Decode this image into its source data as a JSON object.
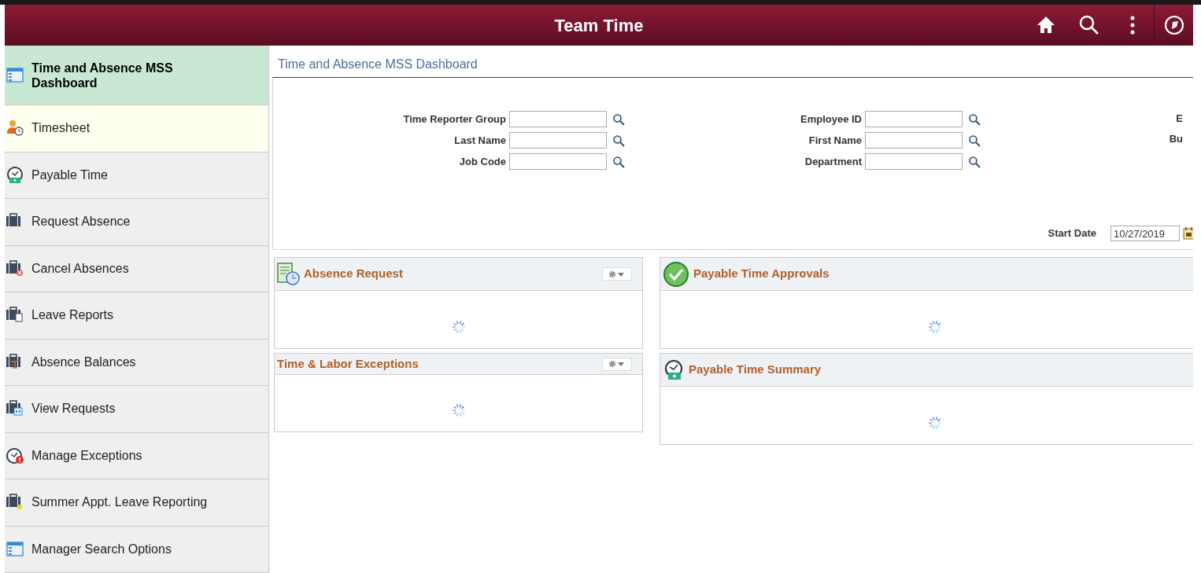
{
  "header": {
    "title": "Team Time",
    "actions": [
      {
        "kind": "home"
      },
      {
        "kind": "search"
      },
      {
        "kind": "more"
      },
      {
        "kind": "navbar"
      }
    ]
  },
  "sidebar": {
    "items": [
      {
        "label": "Time and Absence MSS Dashboard",
        "kind": "window",
        "selected": true,
        "hovered": false
      },
      {
        "label": "Timesheet",
        "kind": "person-clock",
        "selected": false,
        "hovered": true
      },
      {
        "label": "Payable Time",
        "kind": "clock-money",
        "selected": false,
        "hovered": false
      },
      {
        "label": "Request Absence",
        "kind": "briefcase",
        "selected": false,
        "hovered": false
      },
      {
        "label": "Cancel Absences",
        "kind": "briefcase-x",
        "selected": false,
        "hovered": false
      },
      {
        "label": "Leave Reports",
        "kind": "briefcase-doc",
        "selected": false,
        "hovered": false
      },
      {
        "label": "Absence Balances",
        "kind": "briefcase-scale",
        "selected": false,
        "hovered": false
      },
      {
        "label": "View Requests",
        "kind": "briefcase-calendar",
        "selected": false,
        "hovered": false
      },
      {
        "label": "Manage Exceptions",
        "kind": "clock-alert",
        "selected": false,
        "hovered": false
      },
      {
        "label": "Summer Appt. Leave Reporting",
        "kind": "briefcase-dot",
        "selected": false,
        "hovered": false
      },
      {
        "label": "Manager Search Options",
        "kind": "window",
        "selected": false,
        "hovered": false
      }
    ]
  },
  "page_title": "Time and Absence MSS Dashboard",
  "search_columns": [
    [
      {
        "label": "Time Reporter Group"
      },
      {
        "label": "Last Name"
      },
      {
        "label": "Job Code"
      }
    ],
    [
      {
        "label": "Employee ID"
      },
      {
        "label": "First Name"
      },
      {
        "label": "Department"
      }
    ],
    [
      {
        "label": "E"
      },
      {
        "label": "Bu"
      }
    ]
  ],
  "start_date": {
    "label": "Start Date",
    "value": "10/27/2019"
  },
  "pod_columns": [
    [
      {
        "title": "Absence Request",
        "kind": "doc-clock",
        "settings": true
      },
      {
        "title": "Time & Labor Exceptions",
        "kind": "none",
        "settings": true
      }
    ],
    [
      {
        "title": "Payable Time Approvals",
        "kind": "check",
        "settings": false
      },
      {
        "title": "Payable Time Summary",
        "kind": "clock-money",
        "settings": false
      }
    ]
  ]
}
